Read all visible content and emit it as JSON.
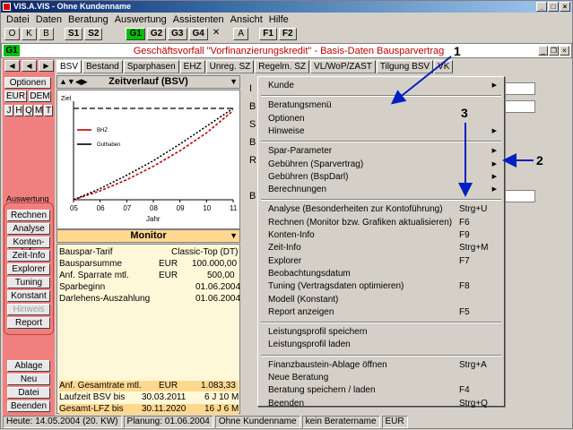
{
  "window": {
    "title": "VIS.A.VIS - Ohne Kundenname"
  },
  "menubar": [
    "Datei",
    "Daten",
    "Beratung",
    "Auswertung",
    "Assistenten",
    "Ansicht",
    "Hilfe"
  ],
  "toolbar": [
    "O",
    "K",
    "B",
    "S1",
    "S2",
    "G1",
    "G2",
    "G3",
    "G4",
    "✕",
    "A",
    "F1",
    "F2"
  ],
  "doc": {
    "badge": "G1",
    "title": "Geschäftsvorfall \"Vorfinanzierungskredit\" - Basis-Daten Bausparvertrag"
  },
  "left": {
    "optionen": "Optionen",
    "eur": "EUR",
    "dem": "DEM",
    "periods": [
      "J",
      "H",
      "Q",
      "M",
      "T"
    ],
    "auswertung_label": "Auswertung",
    "ausw_buttons": [
      "Rechnen",
      "Analyse",
      "Konten-Info",
      "Zeit-Info",
      "Explorer",
      "Tuning",
      "Konstant",
      "Hinweis",
      "Report"
    ],
    "bottom_buttons": [
      "Ablage",
      "Neu",
      "Datei",
      "Beenden"
    ]
  },
  "tabs": [
    "BSV",
    "Bestand",
    "Sparphasen",
    "EHZ",
    "Unreg. SZ",
    "Regelm. SZ",
    "VL/WoP/ZAST",
    "Tilgung BSV"
  ],
  "vk_tab": "VK",
  "graph": {
    "title": "Zeitverlauf (BSV)",
    "ziel": "Ziel",
    "legend": [
      "BHZ",
      "Guthaben"
    ],
    "xlabel": "Jahr",
    "xticks": [
      "05",
      "06",
      "07",
      "08",
      "09",
      "10",
      "11"
    ]
  },
  "chart_data": {
    "type": "line",
    "title": "Zeitverlauf (BSV)",
    "xlabel": "Jahr",
    "categories": [
      "05",
      "06",
      "07",
      "08",
      "09",
      "10",
      "11"
    ],
    "series": [
      {
        "name": "BHZ",
        "values": [
          0,
          8,
          18,
          30,
          44,
          60,
          80
        ]
      },
      {
        "name": "Guthaben",
        "values": [
          0,
          10,
          22,
          35,
          50,
          66,
          82
        ]
      }
    ],
    "target_label": "Ziel"
  },
  "monitor": {
    "title": "Monitor",
    "rows": [
      {
        "label": "Bauspar-Tarif",
        "cur": "",
        "val": "Classic-Top  (DT)"
      },
      {
        "label": "Bausparsumme",
        "cur": "EUR",
        "val": "100.000,00"
      },
      {
        "label": "Anf. Sparrate mtl.",
        "cur": "EUR",
        "val": "500,00"
      },
      {
        "label": "Sparbeginn",
        "cur": "",
        "val": "01.06.2004"
      },
      {
        "label": "Darlehens-Auszahlung",
        "cur": "",
        "val": "01.06.2004"
      }
    ],
    "bottom_rows": [
      {
        "label": "Anf. Gesamtrate mtl.",
        "cur": "EUR",
        "val": "1.083,33"
      },
      {
        "label": "Laufzeit BSV bis",
        "cur": "30.03.2011",
        "val": "6 J 10 M"
      },
      {
        "label": "Gesamt-LFZ bis",
        "cur": "30.11.2020",
        "val": "16 J 6 M"
      }
    ]
  },
  "right_labels": [
    "I",
    "B",
    "S",
    "B",
    "R",
    "B"
  ],
  "context_menu": [
    {
      "label": "Kunde",
      "sub": true
    },
    {
      "sep": true
    },
    {
      "label": "Beratungsmenü"
    },
    {
      "label": "Optionen"
    },
    {
      "label": "Hinweise",
      "sub": true
    },
    {
      "sep": true
    },
    {
      "label": "Spar-Parameter",
      "sub": true
    },
    {
      "label": "Gebühren (Sparvertrag)",
      "sub": true
    },
    {
      "label": "Gebühren (BspDarl)",
      "sub": true
    },
    {
      "label": "Berechnungen",
      "sub": true
    },
    {
      "sep": true
    },
    {
      "label": "Analyse  (Besonderheiten zur Kontoführung)",
      "shortcut": "Strg+U"
    },
    {
      "label": "Rechnen (Monitor bzw. Grafiken aktualisieren)",
      "shortcut": "F6"
    },
    {
      "label": "Konten-Info",
      "shortcut": "F9"
    },
    {
      "label": "Zeit-Info",
      "shortcut": "Strg+M"
    },
    {
      "label": "Explorer",
      "shortcut": "F7"
    },
    {
      "label": "Beobachtungsdatum"
    },
    {
      "label": "Tuning  (Vertragsdaten optimieren)",
      "shortcut": "F8"
    },
    {
      "label": "Modell  (Konstant)"
    },
    {
      "label": "Report anzeigen",
      "shortcut": "F5"
    },
    {
      "sep": true
    },
    {
      "label": "Leistungsprofil speichern"
    },
    {
      "label": "Leistungsprofil laden"
    },
    {
      "sep": true
    },
    {
      "label": "Finanzbaustein-Ablage öffnen",
      "shortcut": "Strg+A"
    },
    {
      "label": "Neue Beratung"
    },
    {
      "label": "Beratung speichern / laden",
      "shortcut": "F4"
    },
    {
      "label": "Beenden",
      "shortcut": "Strg+Q"
    }
  ],
  "annotations": [
    "1",
    "2",
    "3"
  ],
  "status": [
    "Heute: 14.05.2004 (20. KW)",
    "Planung: 01.06.2004",
    "Ohne Kundenname",
    "kein Beratername",
    "EUR"
  ]
}
